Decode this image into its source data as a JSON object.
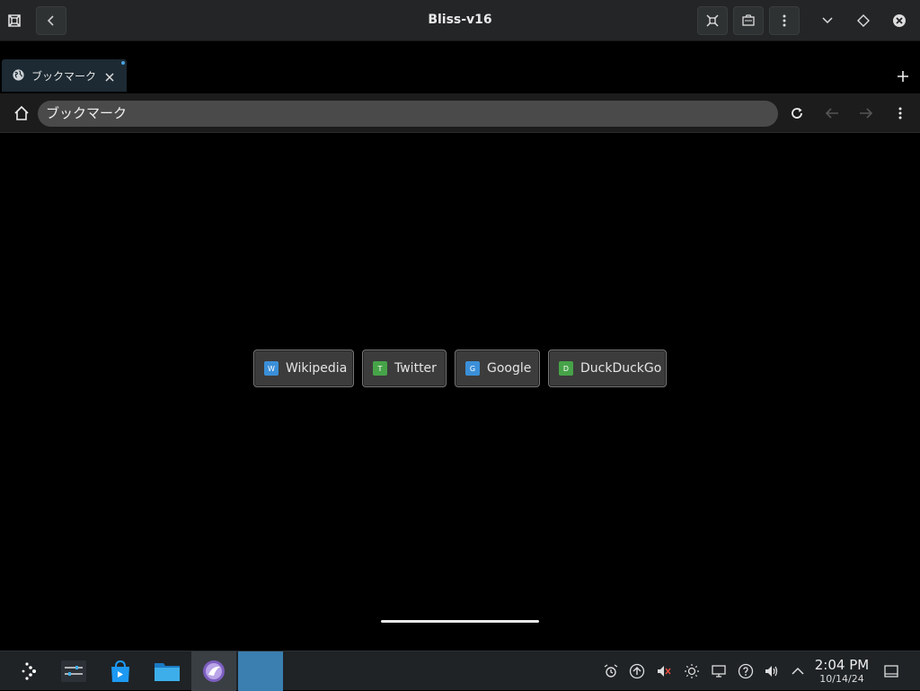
{
  "window": {
    "title": "Bliss-v16"
  },
  "tab": {
    "label": "ブックマーク"
  },
  "address_bar": {
    "value": "ブックマーク"
  },
  "bookmarks": [
    {
      "label": "Wikipedia",
      "favicon_letter": "W",
      "favicon_color": "#3b8fd8"
    },
    {
      "label": "Twitter",
      "favicon_letter": "T",
      "favicon_color": "#46a348"
    },
    {
      "label": "Google",
      "favicon_letter": "G",
      "favicon_color": "#3b8fd8"
    },
    {
      "label": "DuckDuckGo",
      "favicon_letter": "D",
      "favicon_color": "#46a348"
    }
  ],
  "taskbar": {
    "clock_time": "2:04 PM",
    "clock_date": "10/14/24",
    "apps": [
      "app-launcher-icon",
      "settings-sliders-icon",
      "app-store-icon",
      "files-icon",
      "browser-icon",
      "active-window"
    ]
  },
  "colors": {
    "accent": "#3a7fb0",
    "titlebar_bg": "#232526",
    "url_bg": "#4a4a4a"
  }
}
